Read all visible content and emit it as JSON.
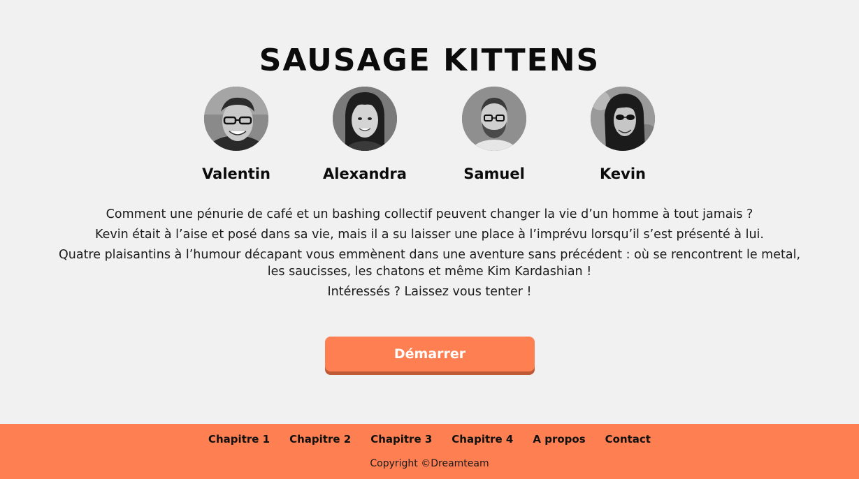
{
  "header": {
    "title": "SAUSAGE KITTENS"
  },
  "members": [
    {
      "name": "Valentin",
      "avatar_icon": "person-photo-glasses"
    },
    {
      "name": "Alexandra",
      "avatar_icon": "person-photo-long-hair"
    },
    {
      "name": "Samuel",
      "avatar_icon": "person-photo-beard"
    },
    {
      "name": "Kevin",
      "avatar_icon": "person-photo-sunglasses-long-hair"
    }
  ],
  "description": {
    "lines": [
      "Comment une pénurie de café et un bashing collectif peuvent changer la vie d’un homme à tout jamais ?",
      "Kevin était à l’aise et posé dans sa vie, mais il a su laisser une place à l’imprévu lorsqu’il s’est présenté à lui.",
      "Quatre plaisantins à l’humour décapant vous emmènent dans une aventure sans précédent : où se rencontrent le metal, les saucisses, les chatons et même Kim Kardashian !",
      "Intéressés ? Laissez vous tenter !"
    ]
  },
  "cta": {
    "label": "Démarrer"
  },
  "footer": {
    "nav": [
      "Chapitre 1",
      "Chapitre 2",
      "Chapitre 3",
      "Chapitre 4",
      "A propos",
      "Contact"
    ],
    "copyright": "Copyright ©Dreamteam"
  },
  "colors": {
    "background": "#f1f1f1",
    "accent": "#fe7f52",
    "accent_shadow": "#c05a36",
    "text": "#111111"
  }
}
